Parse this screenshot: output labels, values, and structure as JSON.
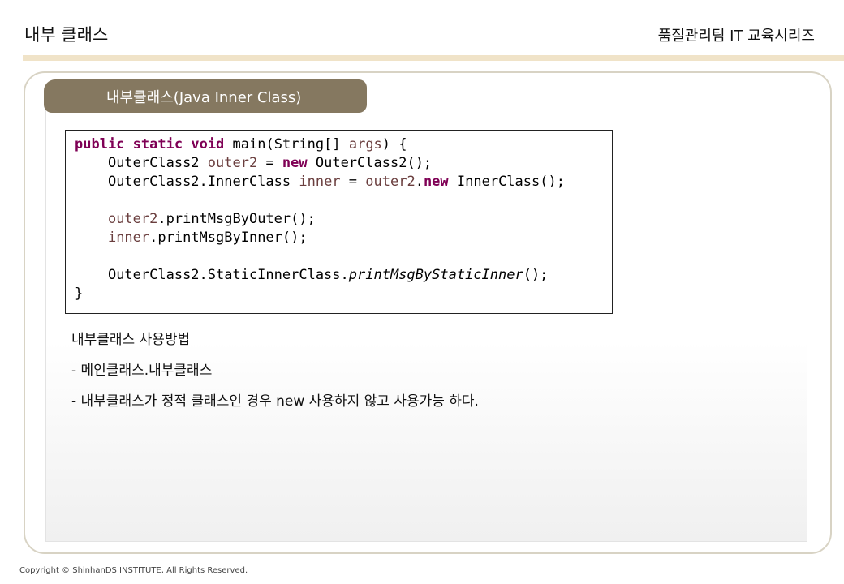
{
  "header": {
    "title": "내부 클래스",
    "series": "품질관리팀 IT 교육시리즈"
  },
  "tab": {
    "label": "내부클래스(Java Inner Class)"
  },
  "code": {
    "l1": {
      "kw1": "public",
      "kw2": "static",
      "kw3": "void",
      "t1": "main(String[] ",
      "v1": "args",
      "t2": ") {"
    },
    "l2": {
      "indent": "    ",
      "t1": "OuterClass2 ",
      "v1": "outer2",
      "t2": " = ",
      "kw1": "new",
      "t3": " OuterClass2();"
    },
    "l3": {
      "indent": "    ",
      "t1": "OuterClass2.InnerClass ",
      "v1": "inner",
      "t2": " = ",
      "v2": "outer2",
      "t3": ".",
      "kw1": "new",
      "t4": " InnerClass();"
    },
    "l4": {
      "indent": "    ",
      "v1": "outer2",
      "t1": ".printMsgByOuter();"
    },
    "l5": {
      "indent": "    ",
      "v1": "inner",
      "t1": ".printMsgByInner();"
    },
    "l6": {
      "indent": "    ",
      "t1": "OuterClass2.StaticInnerClass.",
      "it1": "printMsgByStaticInner",
      "t2": "();"
    },
    "l7": {
      "t1": "}"
    }
  },
  "notes": [
    "내부클래스 사용방법",
    "- 메인클래스.내부클래스",
    "- 내부클래스가 정적 클래스인 경우 new 사용하지 않고 사용가능 하다."
  ],
  "footer": {
    "copyright": "Copyright © ShinhanDS INSTITUTE, All Rights Reserved."
  }
}
